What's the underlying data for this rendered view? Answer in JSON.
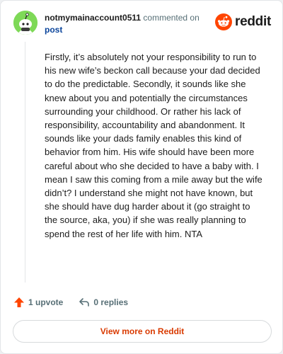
{
  "header": {
    "username": "notmymainaccount0511",
    "action_text": " commented on ",
    "post_link": "post"
  },
  "brand": {
    "logo_icon": "reddit-alien-icon",
    "wordmark": "reddit",
    "color": "#ff4500"
  },
  "comment": {
    "body": "Firstly, it’s absolutely not your responsibility to run to his new wife’s beckon call because your dad decided to do the predictable. Secondly, it sounds like she knew about you and potentially the circumstances surrounding your childhood. Or rather his lack of responsibility, accountability and abandonment. It sounds like your dads family enables this kind of behavior from him. His wife should have been more careful about who she decided to have a baby with. I mean I saw this coming from a mile away but the wife didn’t? I understand she might not have known, but she should have dug harder about it (go straight to the source, aka, you) if she was really planning to spend the rest of her life with him. NTA"
  },
  "actions": {
    "upvote_label": "1 upvote",
    "upvote_icon": "upvote-arrow-icon",
    "upvote_color": "#ff4500",
    "replies_label": "0 replies",
    "replies_icon": "reply-arrow-icon"
  },
  "footer": {
    "view_more_label": "View more on Reddit",
    "accent_color": "#d93a00"
  }
}
